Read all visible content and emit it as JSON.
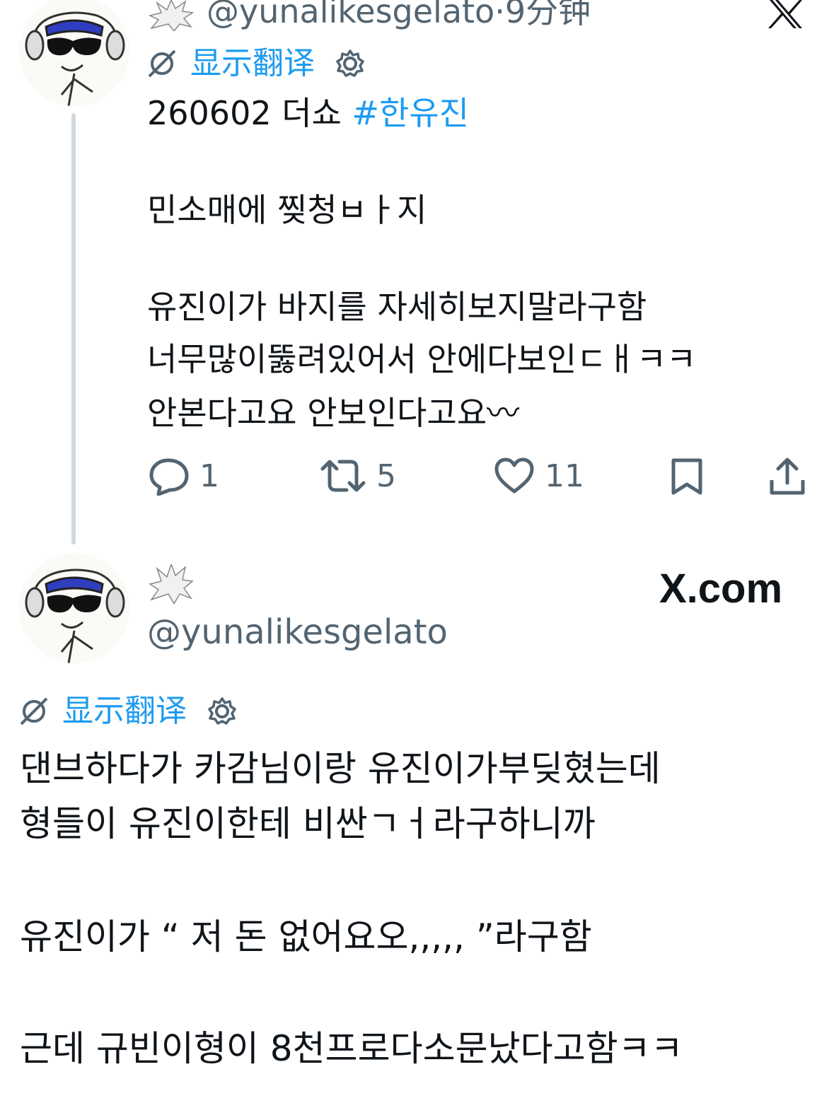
{
  "tweet1": {
    "handle": "@yunalikesgelato",
    "separator": "·",
    "time": "9分钟",
    "translate_label": "显示翻译",
    "line1_prefix": "260602 더쇼 ",
    "hashtag": "#한유진",
    "line2": "민소매에 찢청ㅂㅏ지",
    "line3": "유진이가 바지를 자세히보지말라구함",
    "line4": "너무많이뚫려있어서 안에다보인ㄷㅐㅋㅋ",
    "line5": "안본다고요 안보인다고요〰",
    "actions": {
      "replies": "1",
      "retweets": "5",
      "likes": "11"
    }
  },
  "tweet2": {
    "handle": "@yunalikesgelato",
    "site_label": "X.com",
    "translate_label": "显示翻译",
    "line1": "댄브하다가 카감님이랑 유진이가부딪혔는데",
    "line2": "형들이 유진이한테 비싼ㄱㅓ라구하니까",
    "line3": "유진이가 “ 저 돈 없어요오,,,,, ”라구함",
    "line4": "근데 규빈이형이 8천프로다소문났다고함ㅋㅋ"
  },
  "colors": {
    "text": "#0f1419",
    "muted": "#536471",
    "link": "#1d9bf0",
    "thread_line": "#cfd9de"
  },
  "icons": [
    "avatar-drawing",
    "sparkle-burst-icon",
    "x-logo-icon",
    "translate-icon",
    "gear-icon",
    "reply-icon",
    "retweet-icon",
    "like-icon",
    "bookmark-icon",
    "share-icon"
  ]
}
